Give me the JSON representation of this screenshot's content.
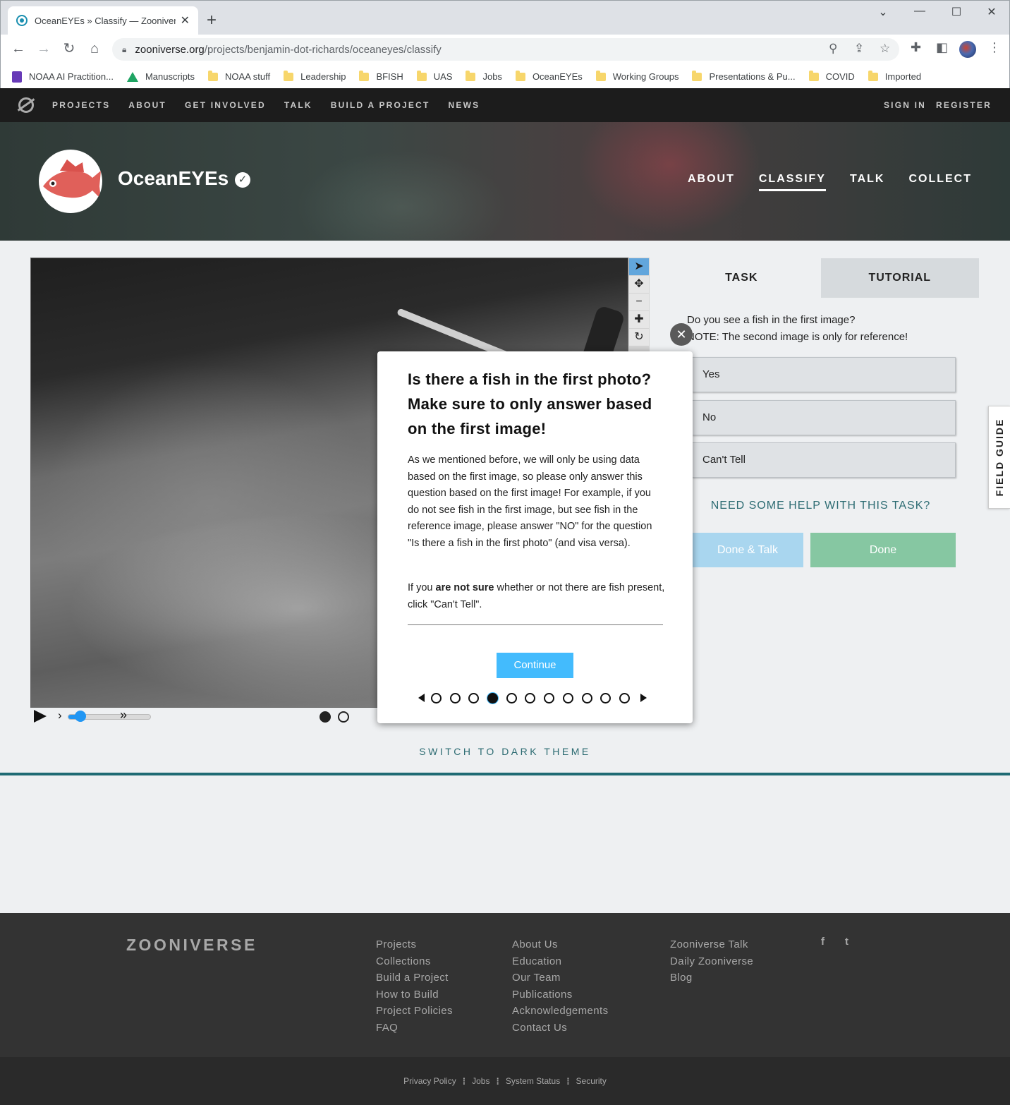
{
  "browser": {
    "tab_title": "OceanEYEs » Classify — Zooniverse",
    "new_tab": "+",
    "url_host": "zooniverse.org",
    "url_path": "/projects/benjamin-dot-richards/oceaneyes/classify",
    "bookmarks": [
      "NOAA AI Practition...",
      "Manuscripts",
      "NOAA stuff",
      "Leadership",
      "BFISH",
      "UAS",
      "Jobs",
      "OceanEYEs",
      "Working Groups",
      "Presentations & Pu...",
      "COVID",
      "Imported"
    ]
  },
  "topnav": {
    "items": [
      "PROJECTS",
      "ABOUT",
      "GET INVOLVED",
      "TALK",
      "BUILD A PROJECT",
      "NEWS"
    ],
    "sign_in": "SIGN IN",
    "register": "REGISTER"
  },
  "project": {
    "name": "OceanEYEs",
    "verified_mark": "✓",
    "nav": [
      "ABOUT",
      "CLASSIFY",
      "TALK",
      "COLLECT"
    ],
    "active_nav": "CLASSIFY"
  },
  "task": {
    "tabs": [
      "TASK",
      "TUTORIAL"
    ],
    "question_line1": "Do you see a fish in the first image?",
    "question_line2": "NOTE: The second image is only for reference!",
    "answers": [
      "Yes",
      "No",
      "Can't Tell"
    ],
    "help": "NEED SOME HELP WITH THIS TASK?",
    "done_talk": "Done & Talk",
    "done": "Done"
  },
  "player": {
    "frames": 2,
    "active_frame": 1,
    "speed_position": 0.15
  },
  "field_guide": "FIELD GUIDE",
  "dark_theme": "SWITCH TO DARK THEME",
  "modal": {
    "title": "Is there a fish in the first photo? Make sure to only answer based on the first image!",
    "para1": "As we mentioned before, we will only be using data based on the first image, so please only answer this question based on the first image! For example, if you do not see fish in the first image, but see fish in the reference image, please answer \"NO\" for the question \"Is there a fish in the first photo\" (and visa versa).",
    "para2_pre": "If you ",
    "para2_bold": "are not sure",
    "para2_post": " whether or not there are fish present, click \"Can't Tell\".",
    "continue": "Continue",
    "close": "✕",
    "step_count": 11,
    "active_step": 4
  },
  "footer": {
    "logo": "ZOONIVERSE",
    "col1": [
      "Projects",
      "Collections",
      "Build a Project",
      "How to Build",
      "Project Policies",
      "FAQ"
    ],
    "col2": [
      "About Us",
      "Education",
      "Our Team",
      "Publications",
      "Acknowledgements",
      "Contact Us"
    ],
    "col3": [
      "Zooniverse Talk",
      "Daily Zooniverse",
      "Blog"
    ],
    "social": [
      "f",
      "t"
    ],
    "bottom": [
      "Privacy Policy",
      "Jobs",
      "System Status",
      "Security"
    ]
  }
}
